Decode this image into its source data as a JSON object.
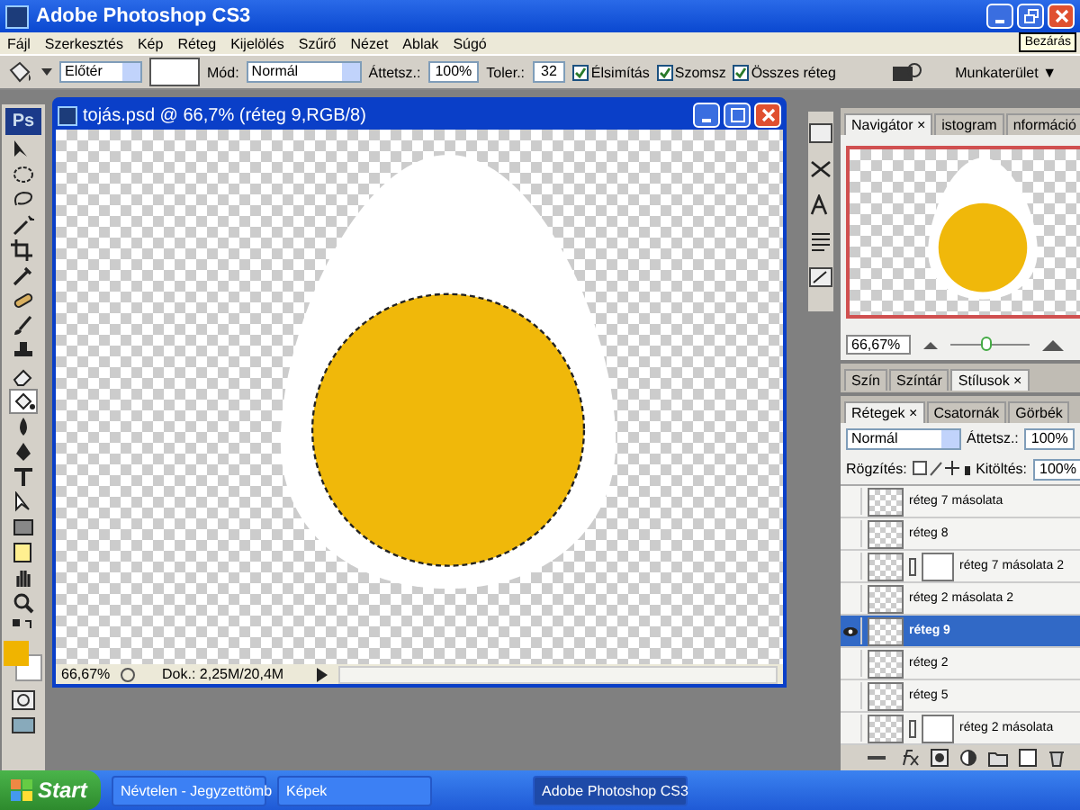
{
  "window": {
    "title": "Adobe Photoshop CS3",
    "tooltip": "Bezárás"
  },
  "menu": [
    "Fájl",
    "Szerkesztés",
    "Kép",
    "Réteg",
    "Kijelölés",
    "Szűrő",
    "Nézet",
    "Ablak",
    "Súgó"
  ],
  "options": {
    "preset": "Előtér",
    "mode_label": "Mód:",
    "mode": "Normál",
    "opacity_label": "Áttetsz.:",
    "opacity": "100%",
    "tolerance_label": "Toler.:",
    "tolerance": "32",
    "workspace": "Munkaterület ▼",
    "checks": [
      {
        "label": "Élsimítás",
        "checked": true
      },
      {
        "label": "Szomsz",
        "checked": true
      },
      {
        "label": "Összes réteg",
        "checked": true
      }
    ]
  },
  "toolbox": {
    "logo": "Ps"
  },
  "document": {
    "title": "tojás.psd @ 66,7% (réteg 9,RGB/8)",
    "zoom": "66,67%",
    "doc_size": "Dok.: 2,25M/20,4M"
  },
  "navigator": {
    "zoom": "66,67%",
    "level": 0.45,
    "tabs": [
      {
        "label": "Navigátor ×",
        "selected": true
      },
      {
        "label": "istogram",
        "selected": false
      },
      {
        "label": "nformáció",
        "selected": false
      }
    ]
  },
  "color_panel": {
    "tabs": [
      {
        "label": "Szín",
        "selected": false
      },
      {
        "label": "Színtár",
        "selected": false
      },
      {
        "label": "Stílusok ×",
        "selected": true
      }
    ]
  },
  "layers": {
    "blend": "Normál",
    "opacity_label": "Áttetsz.:",
    "opacity": "100%",
    "lock_label": "Rögzítés:",
    "fill_label": "Kitöltés:",
    "fill": "100%",
    "tabs": [
      {
        "label": "Rétegek ×",
        "selected": true
      },
      {
        "label": "Csatornák",
        "selected": false
      },
      {
        "label": "Görbék",
        "selected": false
      }
    ],
    "items": [
      {
        "name": "réteg 7 másolata",
        "visible": false,
        "selected": false,
        "mask": false
      },
      {
        "name": "réteg 8",
        "visible": false,
        "selected": false,
        "mask": false
      },
      {
        "name": "réteg 7 másolata 2",
        "visible": false,
        "selected": false,
        "mask": true
      },
      {
        "name": "réteg 2 másolata 2",
        "visible": false,
        "selected": false,
        "mask": false
      },
      {
        "name": "réteg 9",
        "visible": true,
        "selected": true,
        "mask": false
      },
      {
        "name": "réteg 2",
        "visible": false,
        "selected": false,
        "mask": false
      },
      {
        "name": "réteg 5",
        "visible": false,
        "selected": false,
        "mask": false
      },
      {
        "name": "réteg 2 másolata",
        "visible": false,
        "selected": false,
        "mask": true
      }
    ]
  },
  "taskbar": {
    "start": "Start",
    "items": [
      {
        "label": "Névtelen - Jegyzettömb",
        "selected": false
      },
      {
        "label": "Képek",
        "selected": false
      },
      {
        "label": "Adobe Photoshop CS3",
        "selected": true
      }
    ]
  }
}
